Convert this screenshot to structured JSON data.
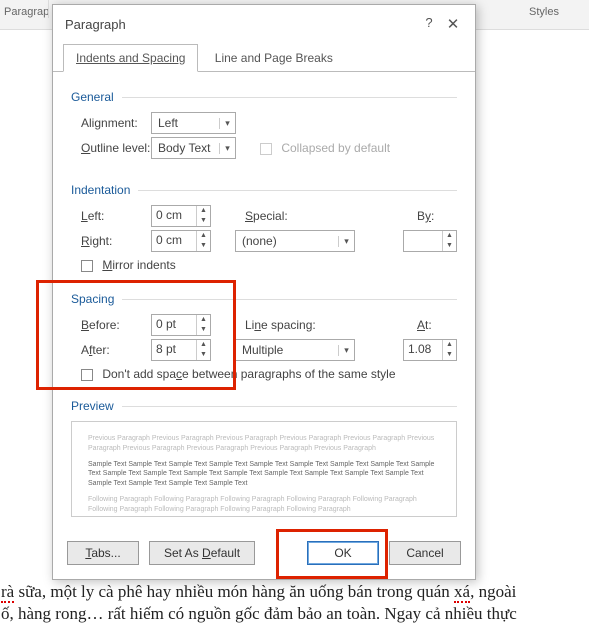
{
  "ribbon": {
    "label_left": "Paragrap",
    "label_right": "Styles"
  },
  "dialog": {
    "title": "Paragraph",
    "help": "?",
    "close": "✕",
    "tabs": {
      "indents": "Indents and Spacing",
      "breaks": "Line and Page Breaks"
    },
    "general": {
      "header": "General",
      "alignment_label": "Alignment:",
      "alignment_value": "Left",
      "outline_label": "Outline level:",
      "outline_value": "Body Text",
      "collapsed_label": "Collapsed by default"
    },
    "indentation": {
      "header": "Indentation",
      "left_label": "Left:",
      "left_value": "0 cm",
      "right_label": "Right:",
      "right_value": "0 cm",
      "special_label": "Special:",
      "special_value": "(none)",
      "by_label": "By:",
      "by_value": "",
      "mirror_label": "Mirror indents"
    },
    "spacing": {
      "header": "Spacing",
      "before_label": "Before:",
      "before_value": "0 pt",
      "after_label": "After:",
      "after_value": "8 pt",
      "line_label": "Line spacing:",
      "line_value": "Multiple",
      "at_label": "At:",
      "at_value": "1.08",
      "noaddspace_label": "Don't add space between paragraphs of the same style"
    },
    "preview": {
      "header": "Preview",
      "prev_text": "Previous Paragraph Previous Paragraph Previous Paragraph Previous Paragraph Previous Paragraph Previous Paragraph Previous Paragraph Previous Paragraph Previous Paragraph Previous Paragraph",
      "sample_text": "Sample Text Sample Text Sample Text Sample Text Sample Text Sample Text Sample Text Sample Text Sample Text Sample Text Sample Text Sample Text Sample Text Sample Text Sample Text Sample Text Sample Text Sample Text Sample Text Sample Text Sample Text",
      "follow_text": "Following Paragraph Following Paragraph Following Paragraph Following Paragraph Following Paragraph Following Paragraph Following Paragraph Following Paragraph Following Paragraph"
    },
    "buttons": {
      "tabs": "Tabs...",
      "default": "Set As Default",
      "ok": "OK",
      "cancel": "Cancel"
    }
  },
  "doc": {
    "line1_a": "rà",
    "line1_b": " sữa, một ly cà phê hay nhiều món hàng ăn uống bán trong quán ",
    "line1_c": "xá",
    "line1_d": ", ngoài",
    "line2": "ố, hàng rong… rất hiếm có nguồn gốc đảm bảo an toàn. Ngay cả nhiều thực"
  }
}
